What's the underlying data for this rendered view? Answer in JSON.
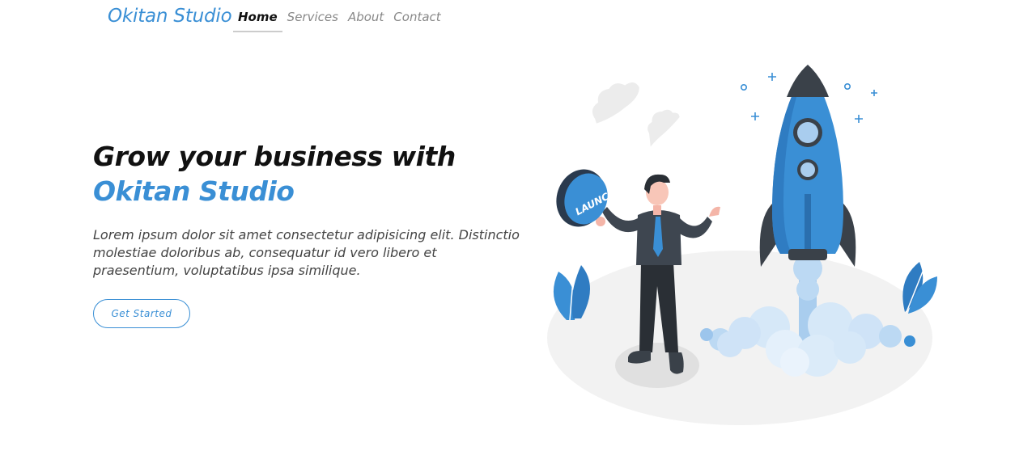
{
  "navbar": {
    "brand": "Okitan Studio",
    "links": [
      {
        "label": "Home",
        "active": true
      },
      {
        "label": "Services",
        "active": false
      },
      {
        "label": "About",
        "active": false
      },
      {
        "label": "Contact",
        "active": false
      }
    ]
  },
  "hero": {
    "title_line1": "Grow your business with",
    "title_line2": "Okitan Studio",
    "description": "Lorem ipsum dolor sit amet consectetur adipisicing elit. Distinctio molestiae doloribus ab, consequatur id vero libero et praesentium, voluptatibus ipsa similique.",
    "cta_label": "Get Started"
  },
  "illustration": {
    "button_text": "LAUNCH",
    "icon": "rocket-launch-illustration"
  },
  "colors": {
    "accent": "#3a8fd5",
    "text_dark": "#111111",
    "text_muted": "#888888"
  }
}
